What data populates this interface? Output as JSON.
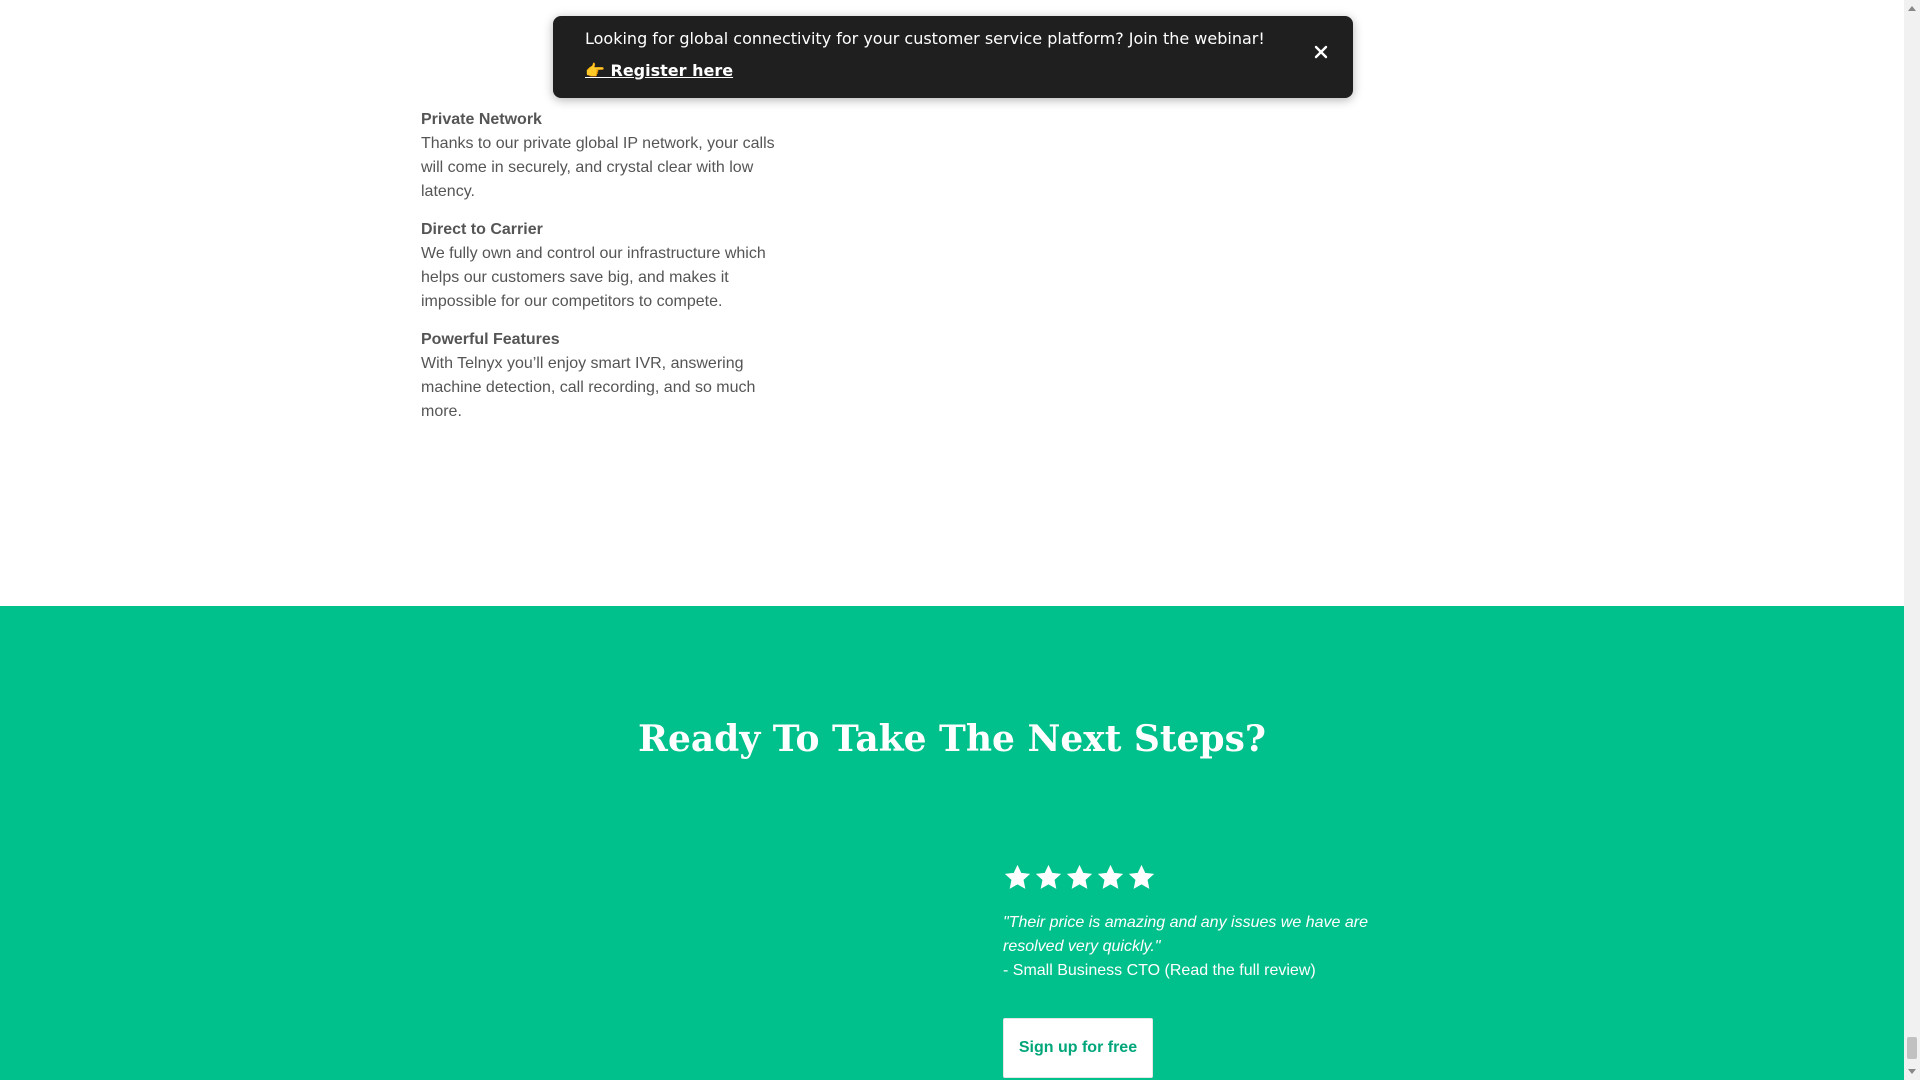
{
  "banner": {
    "message": "Looking for global connectivity for your customer service platform? Join the webinar!",
    "link_label": "👉 Register here"
  },
  "features": [
    {
      "title": "Private Network",
      "text": "Thanks to our private global IP network, your calls will come in securely, and crystal clear with low latency."
    },
    {
      "title": "Direct to Carrier",
      "text": "We fully own and control our infrastructure which helps our customers save big, and makes it impossible for our competitors to compete."
    },
    {
      "title": "Powerful Features",
      "text": "With Telnyx you’ll enjoy smart IVR, answering machine detection, call recording, and so much more."
    }
  ],
  "cta": {
    "title": "Ready To Take The Next Steps?",
    "rating": 5,
    "rating_max": 5,
    "quote": "\"Their price is amazing and any issues we have are resolved very quickly.\"",
    "author": "- Small Business CTO",
    "review_link": "(Read the full review)",
    "signup_label": "Sign up for free"
  },
  "colors": {
    "accent": "#00c08b",
    "banner_bg": "#1f1f1f"
  }
}
